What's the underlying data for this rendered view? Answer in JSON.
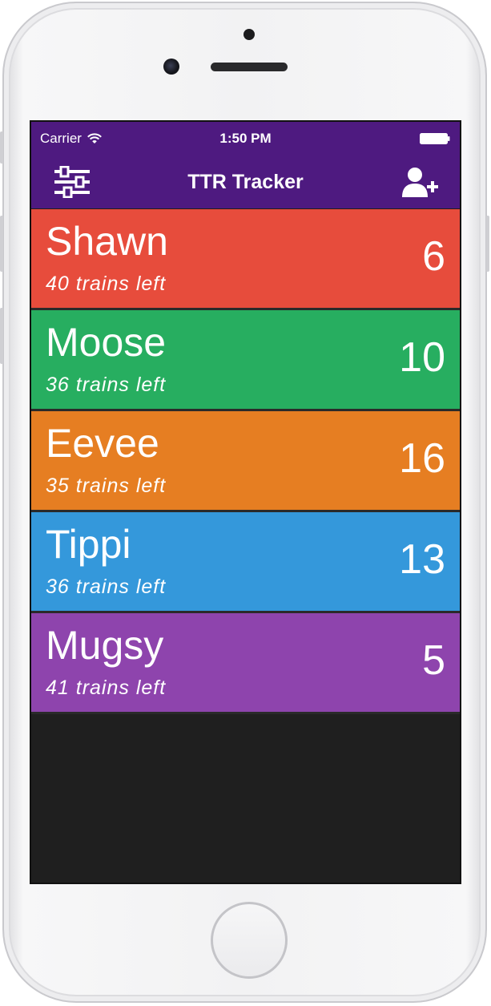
{
  "status_bar": {
    "carrier": "Carrier",
    "time": "1:50 PM",
    "wifi_icon": "wifi-icon",
    "battery_icon": "battery-icon"
  },
  "nav_bar": {
    "title": "TTR Tracker",
    "left_icon": "sliders-icon",
    "right_icon": "add-user-icon",
    "background": "#4e1a80"
  },
  "players": [
    {
      "name": "Shawn",
      "trains": "40 trains left",
      "score": "6",
      "color": "#e74c3c"
    },
    {
      "name": "Moose",
      "trains": "36 trains left",
      "score": "10",
      "color": "#27ae60"
    },
    {
      "name": "Eevee",
      "trains": "35 trains left",
      "score": "16",
      "color": "#e67e22"
    },
    {
      "name": "Tippi",
      "trains": "36 trains left",
      "score": "13",
      "color": "#3498db"
    },
    {
      "name": "Mugsy",
      "trains": "41 trains left",
      "score": "5",
      "color": "#8e44ad"
    }
  ]
}
